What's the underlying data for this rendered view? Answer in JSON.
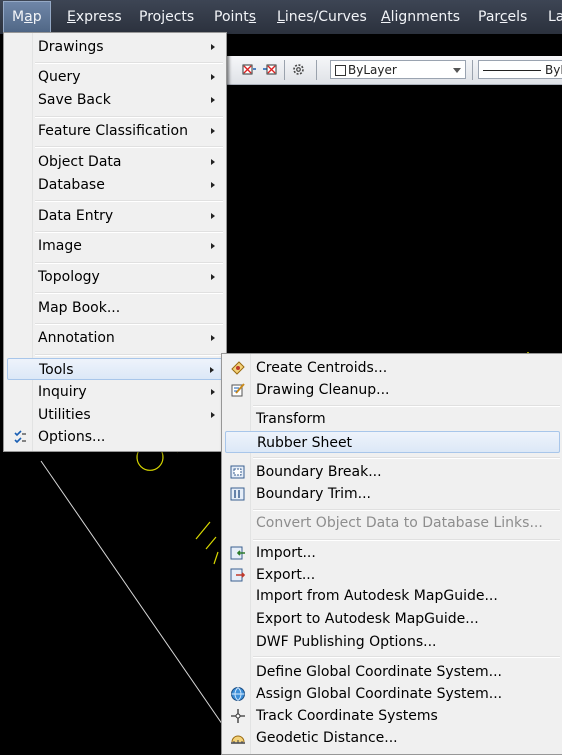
{
  "menubar": {
    "items": [
      {
        "pre": "M",
        "u": "a",
        "post": "p"
      },
      {
        "pre": "",
        "u": "E",
        "post": "xpress"
      },
      {
        "pre": "Pro",
        "u": "j",
        "post": "ects"
      },
      {
        "pre": "Point",
        "u": "s",
        "post": ""
      },
      {
        "pre": "",
        "u": "L",
        "post": "ines/Curves"
      },
      {
        "pre": "",
        "u": "A",
        "post": "lignments"
      },
      {
        "pre": "Par",
        "u": "c",
        "post": "els"
      },
      {
        "pre": "La",
        "u": "",
        "post": ""
      }
    ]
  },
  "toolbar": {
    "layer_combo": "ByLayer",
    "linetype_combo": "ByL"
  },
  "map_menu": {
    "items": [
      {
        "label": "Drawings",
        "submenu": true
      },
      {
        "label": "Query",
        "submenu": true
      },
      {
        "label": "Save Back",
        "submenu": true
      },
      {
        "label": "Feature Classification",
        "submenu": true
      },
      {
        "label": "Object Data",
        "submenu": true
      },
      {
        "label": "Database",
        "submenu": true
      },
      {
        "label": "Data Entry",
        "submenu": true
      },
      {
        "label": "Image",
        "submenu": true
      },
      {
        "label": "Topology",
        "submenu": true
      },
      {
        "label": "Map Book...",
        "submenu": false
      },
      {
        "label": "Annotation",
        "submenu": true
      },
      {
        "label": "Tools",
        "submenu": true
      },
      {
        "label": "Inquiry",
        "submenu": true
      },
      {
        "label": "Utilities",
        "submenu": true
      },
      {
        "label": "Options...",
        "submenu": false
      }
    ]
  },
  "tools_menu": {
    "items": [
      {
        "label": "Create Centroids..."
      },
      {
        "label": "Drawing Cleanup..."
      },
      {
        "label": "Transform"
      },
      {
        "label": "Rubber Sheet"
      },
      {
        "label": "Boundary Break..."
      },
      {
        "label": "Boundary Trim..."
      },
      {
        "label": "Convert Object Data to Database Links..."
      },
      {
        "label": "Import..."
      },
      {
        "label": "Export..."
      },
      {
        "label": "Import from Autodesk MapGuide..."
      },
      {
        "label": "Export to Autodesk MapGuide..."
      },
      {
        "label": "DWF Publishing Options..."
      },
      {
        "label": "Define Global Coordinate System..."
      },
      {
        "label": "Assign Global Coordinate System..."
      },
      {
        "label": "Track Coordinate Systems"
      },
      {
        "label": "Geodetic Distance..."
      }
    ]
  },
  "colors": {
    "menubar": "#2f3542",
    "canvas": "#000000",
    "highlight_border": "#a8c6ea",
    "cad_yellow": "#d8d800"
  }
}
